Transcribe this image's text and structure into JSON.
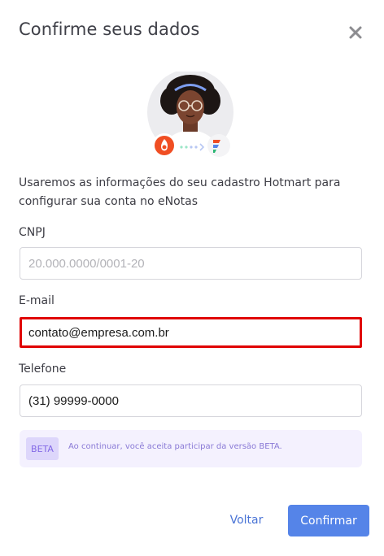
{
  "modal": {
    "title": "Confirme seus dados",
    "close_icon": "close-icon",
    "intro_text": "Usaremos as informações do seu cadastro Hotmart para configurar sua conta no eNotas"
  },
  "illustration": {
    "icons": [
      "avatar",
      "hotmart-logo-icon",
      "arrow-dots-icon",
      "enotas-logo-icon"
    ]
  },
  "form": {
    "cnpj": {
      "label": "CNPJ",
      "value": "",
      "placeholder": "20.000.0000/0001-20"
    },
    "email": {
      "label": "E-mail",
      "value": "contato@empresa.com.br",
      "placeholder": ""
    },
    "phone": {
      "label": "Telefone",
      "value": "(31) 99999-0000",
      "placeholder": ""
    }
  },
  "beta_notice": {
    "badge": "BETA",
    "text": "Ao continuar, você aceita participar da versão BETA."
  },
  "actions": {
    "back_label": "Voltar",
    "confirm_label": "Confirmar"
  },
  "colors": {
    "accent": "#5584e8",
    "highlight_border": "#e00000",
    "beta_bg": "#f4f1fe",
    "beta_text": "#8a7ad6",
    "hotmart": "#f04e23"
  }
}
